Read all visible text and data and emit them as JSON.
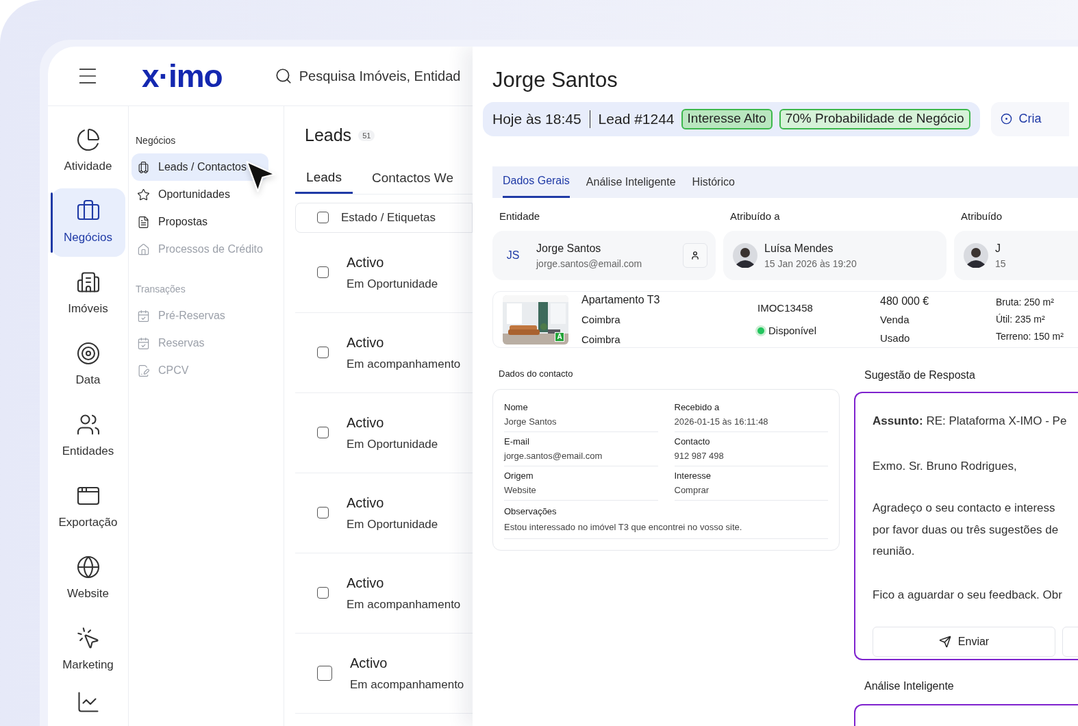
{
  "header": {
    "logo": "x·imo",
    "search": {
      "placeholder": "Pesquisa Imóveis, Entidad"
    }
  },
  "nav": [
    {
      "label": "Atividade",
      "selected": false
    },
    {
      "label": "Negócios",
      "selected": true
    },
    {
      "label": "Imóveis",
      "selected": false
    },
    {
      "label": "Data",
      "selected": false
    },
    {
      "label": "Entidades",
      "selected": false
    },
    {
      "label": "Exportação",
      "selected": false
    },
    {
      "label": "Website",
      "selected": false
    },
    {
      "label": "Marketing",
      "selected": false
    }
  ],
  "submenu": [
    {
      "title": "Negócios",
      "disabled": false,
      "items": [
        {
          "label": "Leads / Contactos",
          "selected": true,
          "disabled": false
        },
        {
          "label": "Oportunidades",
          "selected": false,
          "disabled": false
        },
        {
          "label": "Propostas",
          "selected": false,
          "disabled": false
        },
        {
          "label": "Processos de Crédito",
          "selected": false,
          "disabled": true
        }
      ]
    },
    {
      "title": "Transações",
      "disabled": true,
      "items": [
        {
          "label": "Pré-Reservas",
          "selected": false,
          "disabled": true
        },
        {
          "label": "Reservas",
          "selected": false,
          "disabled": true
        },
        {
          "label": "CPCV",
          "selected": false,
          "disabled": true
        }
      ]
    }
  ],
  "leads": {
    "title": "Leads",
    "count": "51",
    "tabs": [
      {
        "label": "Leads",
        "selected": true
      },
      {
        "label": "Contactos We",
        "selected": false
      }
    ],
    "header": {
      "label": "Estado / Etiquetas",
      "checked": false
    },
    "rows": [
      {
        "status": "Activo",
        "stage": "Em Oportunidade",
        "checked": false
      },
      {
        "status": "Activo",
        "stage": "Em acompanhamento",
        "checked": false
      },
      {
        "status": "Activo",
        "stage": "Em Oportunidade",
        "checked": false
      },
      {
        "status": "Activo",
        "stage": "Em Oportunidade",
        "checked": false
      },
      {
        "status": "Activo",
        "stage": "Em acompanhamento",
        "checked": false
      },
      {
        "status": "Activo",
        "stage": "Em acompanhamento",
        "checked": false
      }
    ]
  },
  "detail": {
    "title": "Jorge Santos",
    "meta": {
      "time": "Hoje às 18:45",
      "lead": "Lead #1244",
      "badges": [
        "Interesse Alto",
        "70% Probabilidade de Negócio"
      ]
    },
    "action": "Cria",
    "tabs": [
      {
        "label": "Dados Gerais",
        "selected": true
      },
      {
        "label": "Análise Inteligente",
        "selected": false
      },
      {
        "label": "Histórico",
        "selected": false
      }
    ],
    "entity": {
      "label": "Entidade",
      "initials": "JS",
      "name": "Jorge Santos",
      "email": "jorge.santos@email.com"
    },
    "assigned": [
      {
        "label": "Atribuído a",
        "name": "Luísa Mendes",
        "date": "15 Jan 2026 às 19:20"
      },
      {
        "label": "Atribuído",
        "name": "J",
        "date": "15"
      }
    ],
    "property": {
      "title": "Apartamento T3",
      "location": [
        "Coimbra",
        "Coimbra"
      ],
      "energy": "A",
      "ref": "IMOC13458",
      "status": {
        "label": "Disponível",
        "color": "#22c55e"
      },
      "price": "480 000 €",
      "deal": "Venda",
      "condition": "Usado",
      "areas": [
        "Bruta: 250 m²",
        "Útil: 235 m²",
        "Terreno: 150 m²"
      ]
    },
    "contact": {
      "title": "Dados do contacto",
      "fields": [
        {
          "label": "Nome",
          "value": "Jorge Santos"
        },
        {
          "label": "Recebido a",
          "value": "2026-01-15 às 16:11:48"
        },
        {
          "label": "E-mail",
          "value": "jorge.santos@email.com"
        },
        {
          "label": "Contacto",
          "value": "912 987 498"
        },
        {
          "label": "Origem",
          "value": "Website"
        },
        {
          "label": "Interesse",
          "value": "Comprar"
        }
      ],
      "notes": {
        "label": "Observações",
        "value": "Estou interessado no imóvel T3 que encontrei no vosso site."
      }
    },
    "reply": {
      "title": "Sugestão de Resposta",
      "subject": "**Assunto:** RE: Plataforma X-IMO - Pe",
      "greeting": "Exmo. Sr. Bruno Rodrigues,",
      "body": [
        "Agradeço o seu contacto e interess",
        "por favor duas ou três sugestões de",
        "reunião."
      ],
      "closing": "Fico a aguardar o seu feedback. Obr",
      "send": "Enviar"
    },
    "analysis": {
      "title": "Análise Inteligente"
    }
  }
}
